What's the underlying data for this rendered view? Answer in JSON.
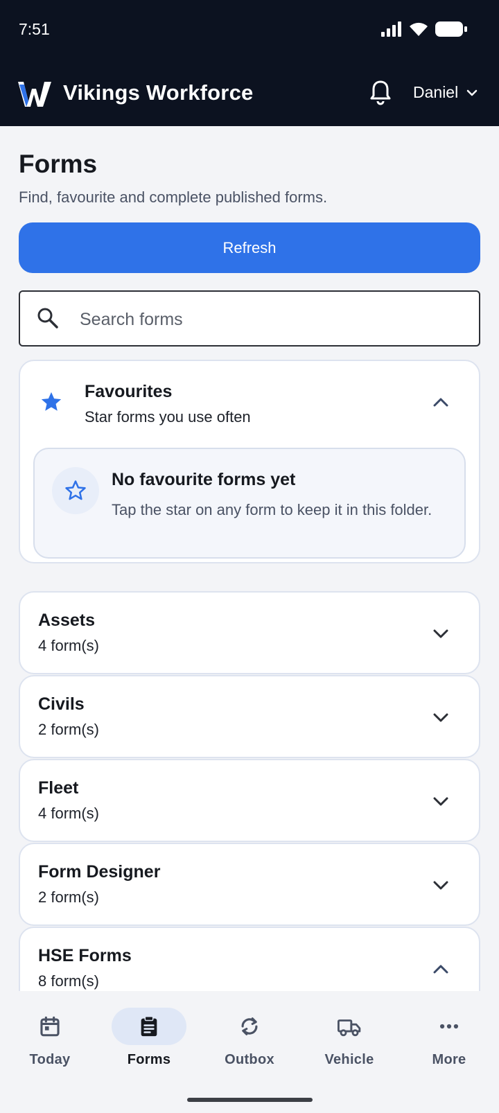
{
  "status_bar": {
    "time": "7:51"
  },
  "header": {
    "app_title": "Vikings Workforce",
    "user_name": "Daniel"
  },
  "page": {
    "title": "Forms",
    "subtitle": "Find, favourite and complete published forms.",
    "refresh_label": "Refresh",
    "search_placeholder": "Search forms"
  },
  "favourites": {
    "title": "Favourites",
    "subtitle": "Star forms you use often",
    "empty_title": "No favourite forms yet",
    "empty_desc": "Tap the star on any form to keep it in this folder."
  },
  "categories": [
    {
      "name": "Assets",
      "count": "4 form(s)",
      "expanded": false
    },
    {
      "name": "Civils",
      "count": "2 form(s)",
      "expanded": false
    },
    {
      "name": "Fleet",
      "count": "4 form(s)",
      "expanded": false
    },
    {
      "name": "Form Designer",
      "count": "2 form(s)",
      "expanded": false
    },
    {
      "name": "HSE Forms",
      "count": "8 form(s)",
      "expanded": true
    }
  ],
  "bottom_nav": [
    {
      "label": "Today",
      "icon": "calendar-icon",
      "active": false
    },
    {
      "label": "Forms",
      "icon": "clipboard-icon",
      "active": true
    },
    {
      "label": "Outbox",
      "icon": "sync-icon",
      "active": false
    },
    {
      "label": "Vehicle",
      "icon": "truck-icon",
      "active": false
    },
    {
      "label": "More",
      "icon": "more-icon",
      "active": false
    }
  ],
  "colors": {
    "header_bg": "#0c1220",
    "accent": "#2f72e8",
    "page_bg": "#f3f4f7"
  }
}
